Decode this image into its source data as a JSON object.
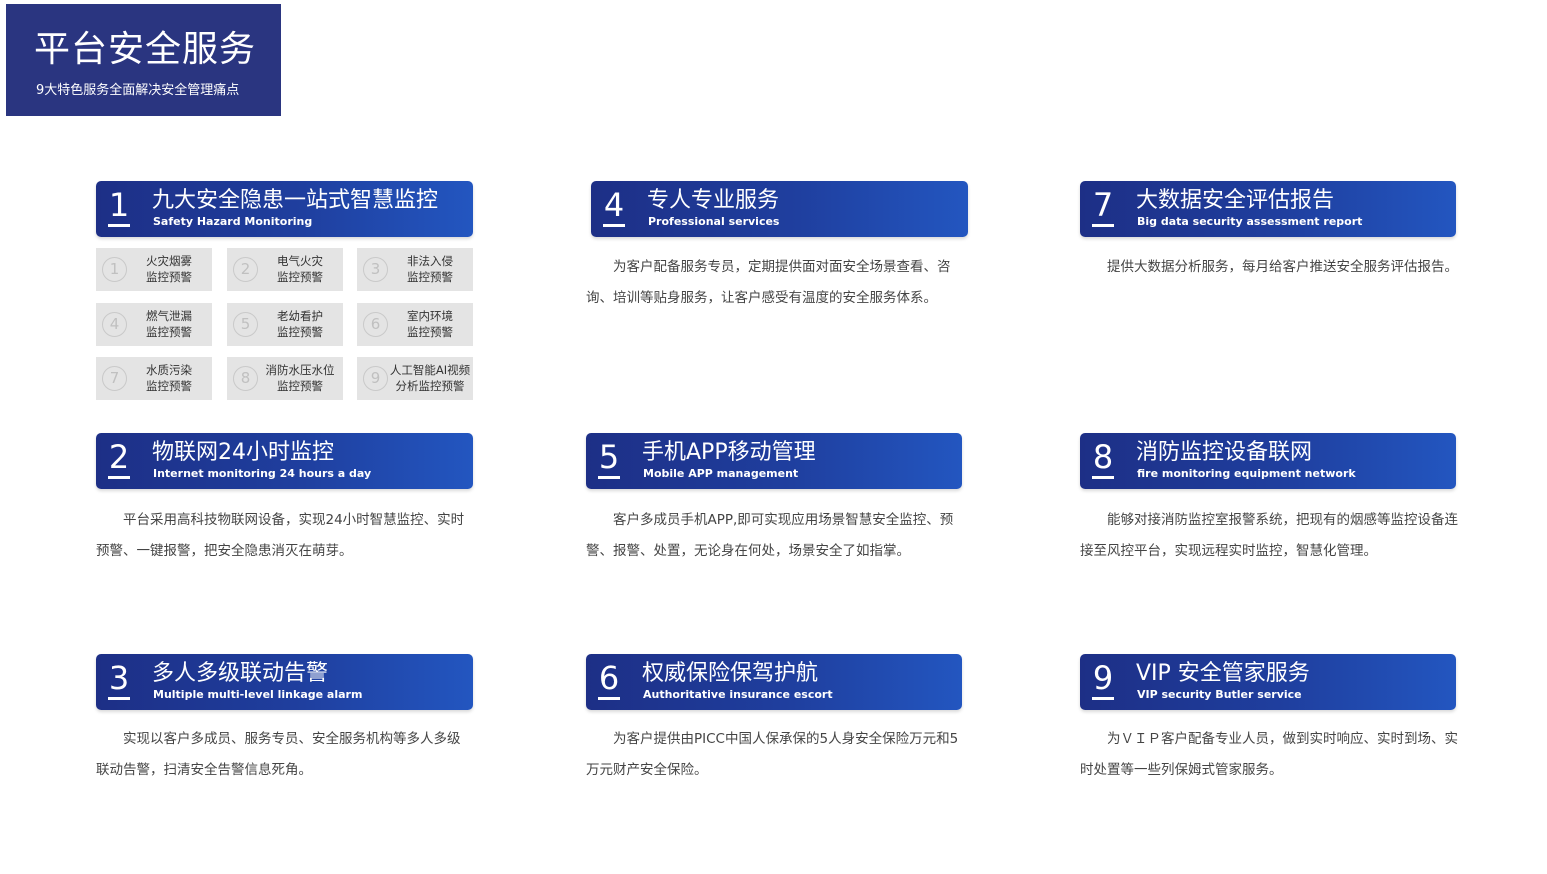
{
  "title": {
    "main": "平台安全服务",
    "sub": "9大特色服务全面解决安全管理痛点"
  },
  "colors": {
    "header_dark": "#1d2f86",
    "header_light": "#2356c0",
    "title_block": "#2a3580"
  },
  "services": [
    {
      "number": "1",
      "title": "九大安全隐患一站式智慧监控",
      "subtitle": "Safety Hazard Monitoring",
      "description": ""
    },
    {
      "number": "2",
      "title": "物联网24小时监控",
      "subtitle": "Internet monitoring 24 hours a day",
      "description": "平台采用高科技物联网设备，实现24小时智慧监控、实时预警、一键报警，把安全隐患消灭在萌芽。"
    },
    {
      "number": "3",
      "title": "多人多级联动告警",
      "subtitle": "Multiple multi-level linkage alarm",
      "description": "实现以客户多成员、服务专员、安全服务机构等多人多级联动告警，扫清安全告警信息死角。"
    },
    {
      "number": "4",
      "title": "专人专业服务",
      "subtitle": "Professional services",
      "description": "为客户配备服务专员，定期提供面对面安全场景查看、咨询、培训等贴身服务，让客户感受有温度的安全服务体系。"
    },
    {
      "number": "5",
      "title": "手机APP移动管理",
      "subtitle": "Mobile APP management",
      "description": "客户多成员手机APP,即可实现应用场景智慧安全监控、预警、报警、处置，无论身在何处，场景安全了如指掌。"
    },
    {
      "number": "6",
      "title": "权威保险保驾护航",
      "subtitle": "Authoritative insurance escort",
      "description": "为客户提供由PICC中国人保承保的5人身安全保险万元和5万元财产安全保险。"
    },
    {
      "number": "7",
      "title": "大数据安全评估报告",
      "subtitle": "Big data security assessment report",
      "description": "提供大数据分析服务，每月给客户推送安全服务评估报告。"
    },
    {
      "number": "8",
      "title": "消防监控设备联网",
      "subtitle": "fire monitoring equipment network",
      "description": "能够对接消防监控室报警系统，把现有的烟感等监控设备连接至风控平台，实现远程实时监控，智慧化管理。"
    },
    {
      "number": "9",
      "title": "VIP 安全管家服务",
      "subtitle": "VIP security Butler service",
      "description": "为ＶＩＰ客户配备专业人员，做到实时响应、实时到场、实时处置等一些列保姆式管家服务。"
    }
  ],
  "hazards": [
    {
      "num": "1",
      "line1": "火灾烟雾",
      "line2": "监控预警"
    },
    {
      "num": "2",
      "line1": "电气火灾",
      "line2": "监控预警"
    },
    {
      "num": "3",
      "line1": "非法入侵",
      "line2": "监控预警"
    },
    {
      "num": "4",
      "line1": "燃气泄漏",
      "line2": "监控预警"
    },
    {
      "num": "5",
      "line1": "老幼看护",
      "line2": "监控预警"
    },
    {
      "num": "6",
      "line1": "室内环境",
      "line2": "监控预警"
    },
    {
      "num": "7",
      "line1": "水质污染",
      "line2": "监控预警"
    },
    {
      "num": "8",
      "line1": "消防水压水位",
      "line2": "监控预警"
    },
    {
      "num": "9",
      "line1": "人工智能AI视频",
      "line2": "分析监控预警"
    }
  ]
}
